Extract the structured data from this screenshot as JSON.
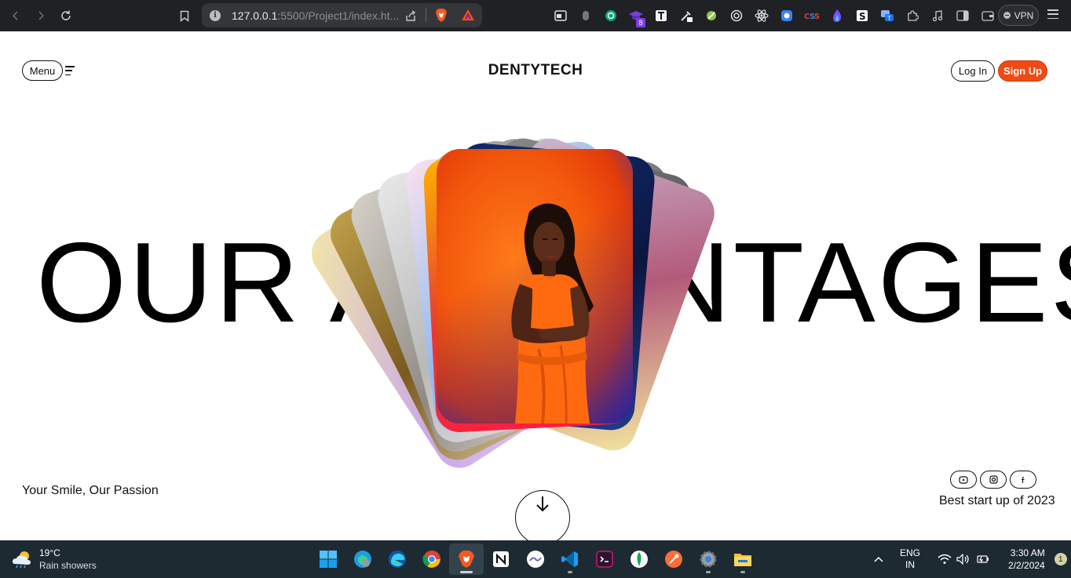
{
  "browser": {
    "url_host": "127.0.0.1",
    "url_rest": ":5500/Project1/index.ht...",
    "vpn_label": "VPN",
    "extension_badge": "8"
  },
  "header": {
    "menu_label": "Menu",
    "brand": "DENTYTECH",
    "login_label": "Log In",
    "signup_label": "Sign Up",
    "accent_color": "#f04a14"
  },
  "hero": {
    "headline": "OUR ADVANTAGES",
    "tagline": "Your Smile, Our Passion",
    "award": "Best start up of 2023",
    "social": [
      "youtube-icon",
      "instagram-icon",
      "facebook-icon"
    ]
  },
  "taskbar": {
    "temperature": "19°C",
    "weather": "Rain showers",
    "lang_top": "ENG",
    "lang_bottom": "IN",
    "time": "3:30 AM",
    "date": "2/2/2024",
    "notifications": "1"
  }
}
